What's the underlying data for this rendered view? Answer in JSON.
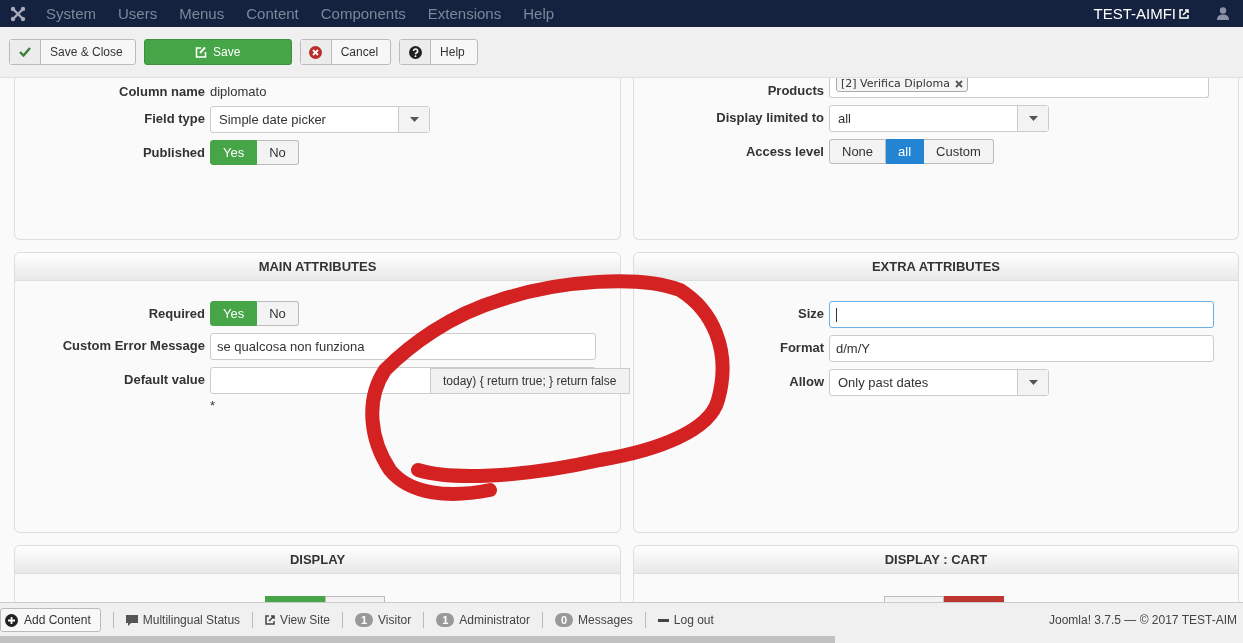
{
  "navbar": {
    "menu": [
      "System",
      "Users",
      "Menus",
      "Content",
      "Components",
      "Extensions",
      "Help"
    ],
    "site": "TEST-AIMFI"
  },
  "toolbar": [
    {
      "label": "Save & Close",
      "kind": "check"
    },
    {
      "label": "Save",
      "kind": "primary"
    },
    {
      "label": "Cancel",
      "kind": "cancel"
    },
    {
      "label": "Help",
      "kind": "help"
    }
  ],
  "top_panels": [
    {
      "rows": [
        {
          "label": "Column name",
          "kind": "static",
          "value": "diplomato"
        },
        {
          "label": "Field type",
          "kind": "select",
          "value": "Simple date picker"
        },
        {
          "label": "Published",
          "kind": "toggle",
          "options": [
            {
              "label": "Yes",
              "selected": true,
              "color": "#46a546"
            },
            {
              "label": "No",
              "selected": false
            }
          ]
        }
      ]
    },
    {
      "rows": [
        {
          "label": "Products",
          "kind": "tags",
          "tags": [
            "[2] Verifica Diploma"
          ]
        },
        {
          "label": "Display limited to",
          "kind": "select",
          "value": "all"
        },
        {
          "label": "Access level",
          "kind": "toggle",
          "options": [
            {
              "label": "None",
              "selected": false
            },
            {
              "label": "all",
              "selected": true,
              "color": "#2384d3"
            },
            {
              "label": "Custom",
              "selected": false
            }
          ]
        }
      ]
    }
  ],
  "attribute_panels": [
    {
      "title": "MAIN ATTRIBUTES",
      "rows": [
        {
          "label": "Required",
          "kind": "toggle",
          "options": [
            {
              "label": "Yes",
              "selected": true,
              "color": "#46a546"
            },
            {
              "label": "No",
              "selected": false
            }
          ]
        },
        {
          "label": "Custom Error Message",
          "kind": "text",
          "value": "se qualcosa non funziona"
        },
        {
          "label": "Default value",
          "kind": "text",
          "hint": "*",
          "popover": "today) { return true; } return false"
        }
      ]
    },
    {
      "title": "EXTRA ATTRIBUTES",
      "rows": [
        {
          "label": "Size",
          "kind": "text",
          "focused": true
        },
        {
          "label": "Format",
          "kind": "text",
          "value": "d/m/Y"
        },
        {
          "label": "Allow",
          "kind": "select",
          "value": "Only past dates"
        }
      ]
    }
  ],
  "display_panels": [
    {
      "title": "DISPLAY",
      "options": [
        {
          "selected": true,
          "color": "#46a546"
        },
        {
          "selected": false
        }
      ]
    },
    {
      "title": "DISPLAY : CART",
      "options": [
        {
          "selected": false
        },
        {
          "selected": true,
          "color": "#bd362f"
        }
      ]
    }
  ],
  "status_bar": {
    "add_button": "Add Content",
    "links": [
      {
        "kind": "comment",
        "label": "Multilingual Status"
      },
      {
        "kind": "external",
        "label": "View Site"
      },
      {
        "kind": "badge",
        "count": "1",
        "label": "Visitor"
      },
      {
        "kind": "badge",
        "count": "1",
        "label": "Administrator"
      },
      {
        "kind": "badge",
        "count": "0",
        "label": "Messages"
      },
      {
        "kind": "logout",
        "label": "Log out"
      }
    ],
    "footer": "Joomla! 3.7.5 — © 2017 TEST-AIM"
  }
}
